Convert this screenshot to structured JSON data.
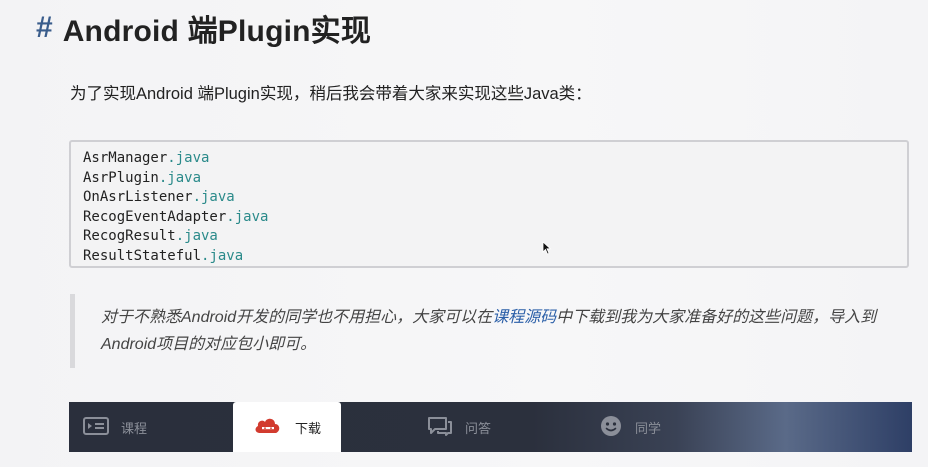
{
  "heading": {
    "hash": "#",
    "title": "Android 端Plugin实现"
  },
  "intro": "为了实现Android 端Plugin实现，稍后我会带着大家来实现这些Java类：",
  "code": [
    {
      "name": "AsrManager",
      "ext": ".java"
    },
    {
      "name": "AsrPlugin",
      "ext": ".java"
    },
    {
      "name": "OnAsrListener",
      "ext": ".java"
    },
    {
      "name": "RecogEventAdapter",
      "ext": ".java"
    },
    {
      "name": "RecogResult",
      "ext": ".java"
    },
    {
      "name": "ResultStateful",
      "ext": ".java"
    }
  ],
  "quote": {
    "before": "对于不熟悉Android开发的同学也不用担心，大家可以在",
    "link": "课程源码",
    "after": "中下载到我为大家准备好的这些问题，导入到Android项目的对应包小即可。"
  },
  "tabs": {
    "course": "课程",
    "download": "下载",
    "qa": "问答",
    "classmates": "同学",
    "active": "download"
  },
  "colors": {
    "hash": "#3a5d8c",
    "code_ext": "#2a8a8a",
    "link": "#2b5fa8",
    "download_icon": "#d23b2f"
  },
  "icons": {
    "course": "video-card-icon",
    "download": "cloud-download-icon",
    "qa": "chat-bubble-icon",
    "classmates": "smiley-face-icon",
    "pointer": "mouse-pointer-icon"
  }
}
